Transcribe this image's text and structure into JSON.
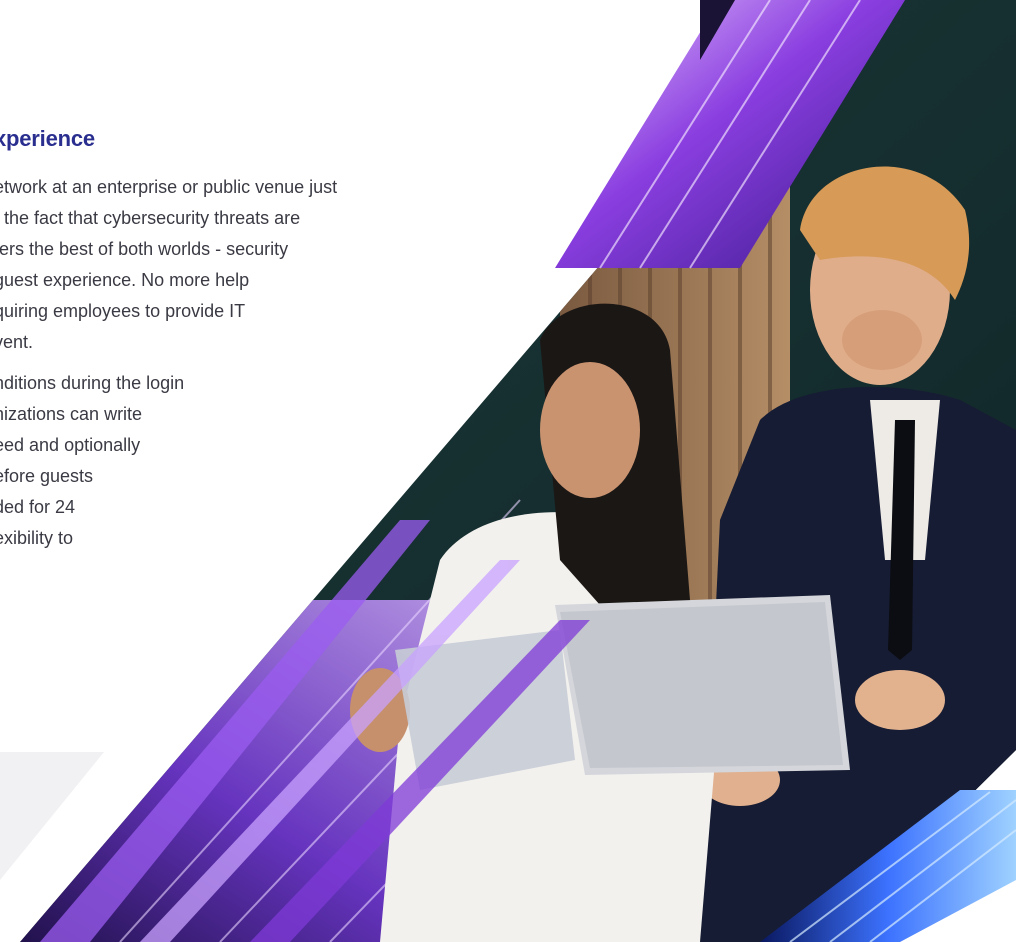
{
  "section": {
    "heading": "xperience",
    "paragraph1": [
      "etwork at an enterprise or public venue just",
      "f the fact that cybersecurity threats are",
      "fers the best of both worlds - security",
      "guest experience. No more help",
      "quiring employees to provide IT",
      "vent."
    ],
    "paragraph2": [
      "nditions during the login",
      "nizations can write",
      "eed and optionally",
      "efore guests",
      "ded for 24",
      "exibility to"
    ]
  },
  "image": {
    "description_icon": "business-people-photo",
    "accent_color": "#7a2bd1",
    "accent_color_2": "#2a54e0",
    "heading_color": "#2a2f8f"
  }
}
